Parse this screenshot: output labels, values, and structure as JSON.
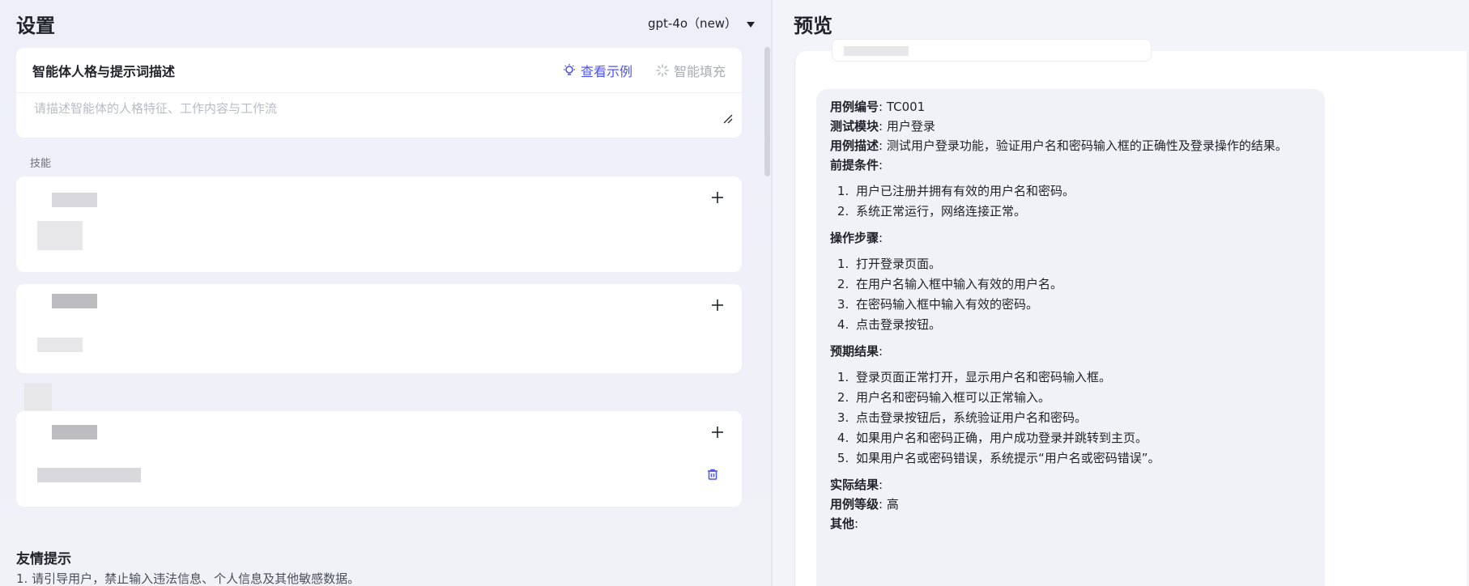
{
  "settings": {
    "title": "设置",
    "model": "gpt-4o（new）",
    "prompt": {
      "title": "智能体人格与提示词描述",
      "view_example": "查看示例",
      "smart_fill": "智能填充",
      "placeholder": "请描述智能体的人格特征、工作内容与工作流"
    },
    "skills_label": "技能",
    "tips": {
      "title": "友情提示",
      "line1": "1. 请引导用户，禁止输入违法信息、个人信息及其他敏感数据。"
    }
  },
  "preview": {
    "title": "预览",
    "test_case": {
      "id_label": "用例编号",
      "id_value": ": TC001",
      "module_label": "测试模块",
      "module_value": ": 用户登录",
      "desc_label": "用例描述",
      "desc_value": ": 测试用户登录功能，验证用户名和密码输入框的正确性及登录操作的结果。",
      "pre_label": "前提条件",
      "pre_items": [
        "用户已注册并拥有有效的用户名和密码。",
        "系统正常运行，网络连接正常。"
      ],
      "steps_label": "操作步骤",
      "steps_items": [
        "打开登录页面。",
        "在用户名输入框中输入有效的用户名。",
        "在密码输入框中输入有效的密码。",
        "点击登录按钮。"
      ],
      "expected_label": "预期结果",
      "expected_items": [
        "登录页面正常打开，显示用户名和密码输入框。",
        "用户名和密码输入框可以正常输入。",
        "点击登录按钮后，系统验证用户名和密码。",
        "如果用户名和密码正确，用户成功登录并跳转到主页。",
        "如果用户名或密码错误，系统提示“用户名或密码错误”。"
      ],
      "actual_label": "实际结果",
      "level_label": "用例等级",
      "level_value": ": 高",
      "other_label": "其他"
    }
  },
  "colors": {
    "accent": "#4d53e8",
    "danger": "#4d53e8"
  }
}
